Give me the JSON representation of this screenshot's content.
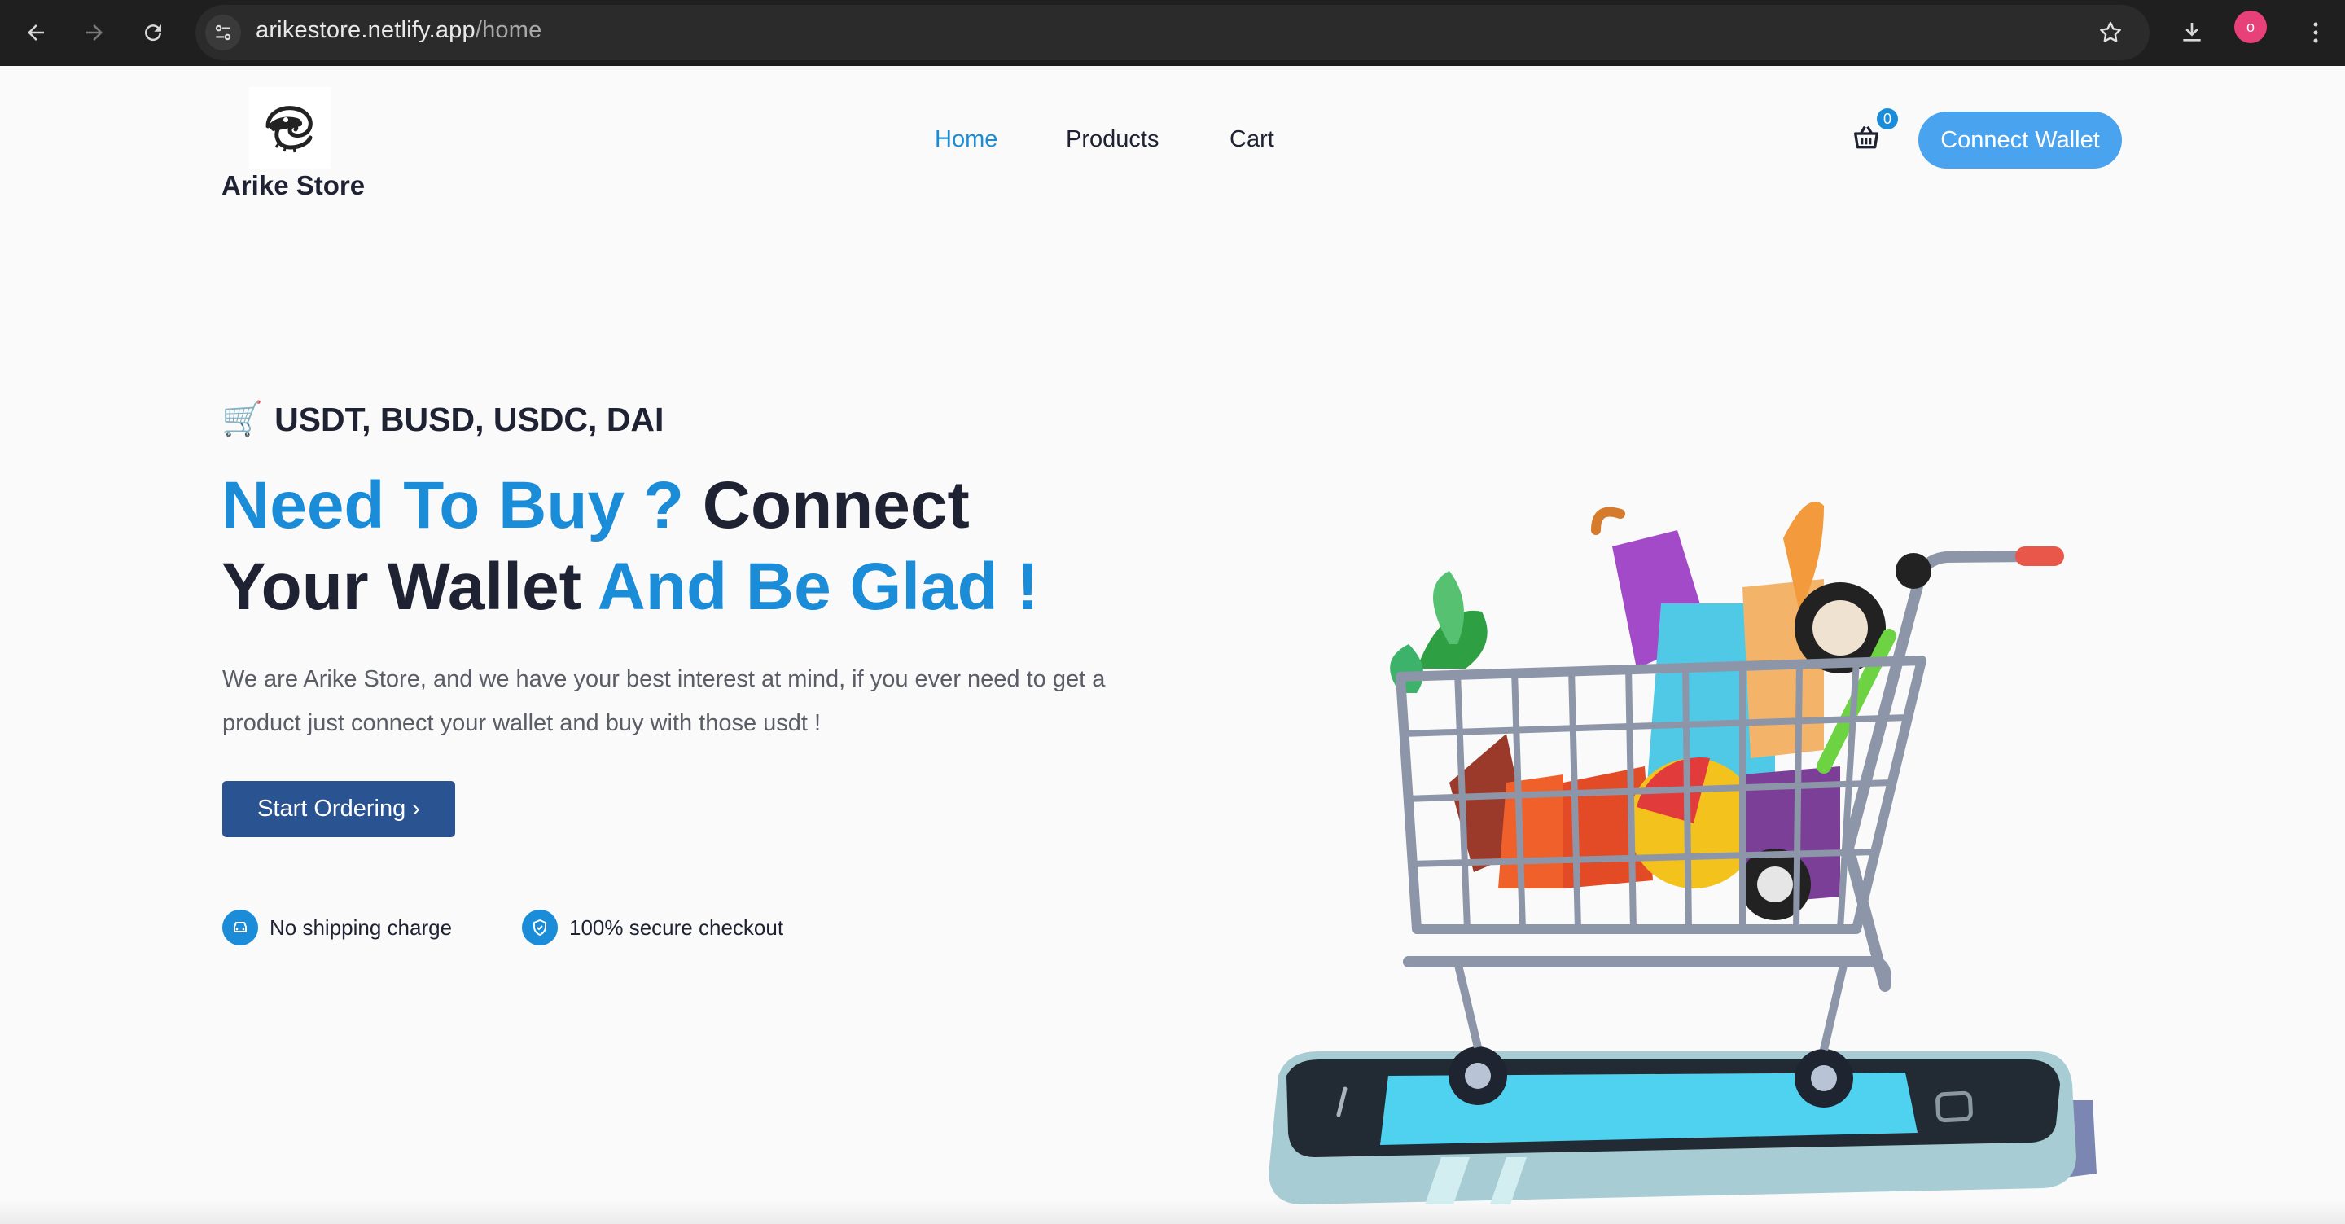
{
  "browser": {
    "url_host": "arikestore.netlify.app",
    "url_path": "/home",
    "profile_initial": "o"
  },
  "nav": {
    "brand": "Arike Store",
    "links": [
      "Home",
      "Products",
      "Cart"
    ],
    "active": "Home",
    "cart_count": "0",
    "connect_label": "Connect Wallet"
  },
  "hero": {
    "tagline_icon": "🛒",
    "tagline": "USDT, BUSD, USDC, DAI",
    "headline_part1": "Need To Buy ?",
    "headline_part2": "Connect",
    "headline_part3": "Your Wallet",
    "headline_part4": "And Be Glad !",
    "description": "We are Arike Store, and we have your best interest at mind, if you ever need to get a product just connect your wallet and buy with those usdt !",
    "cta_label": "Start Ordering ›"
  },
  "features": [
    {
      "icon": "car-icon",
      "label": "No shipping charge"
    },
    {
      "icon": "shield-icon",
      "label": "100% secure checkout"
    }
  ],
  "colors": {
    "accent": "#1a8cd8",
    "cta": "#2a5391",
    "connect": "#4aa3ee",
    "text": "#1e2233"
  }
}
